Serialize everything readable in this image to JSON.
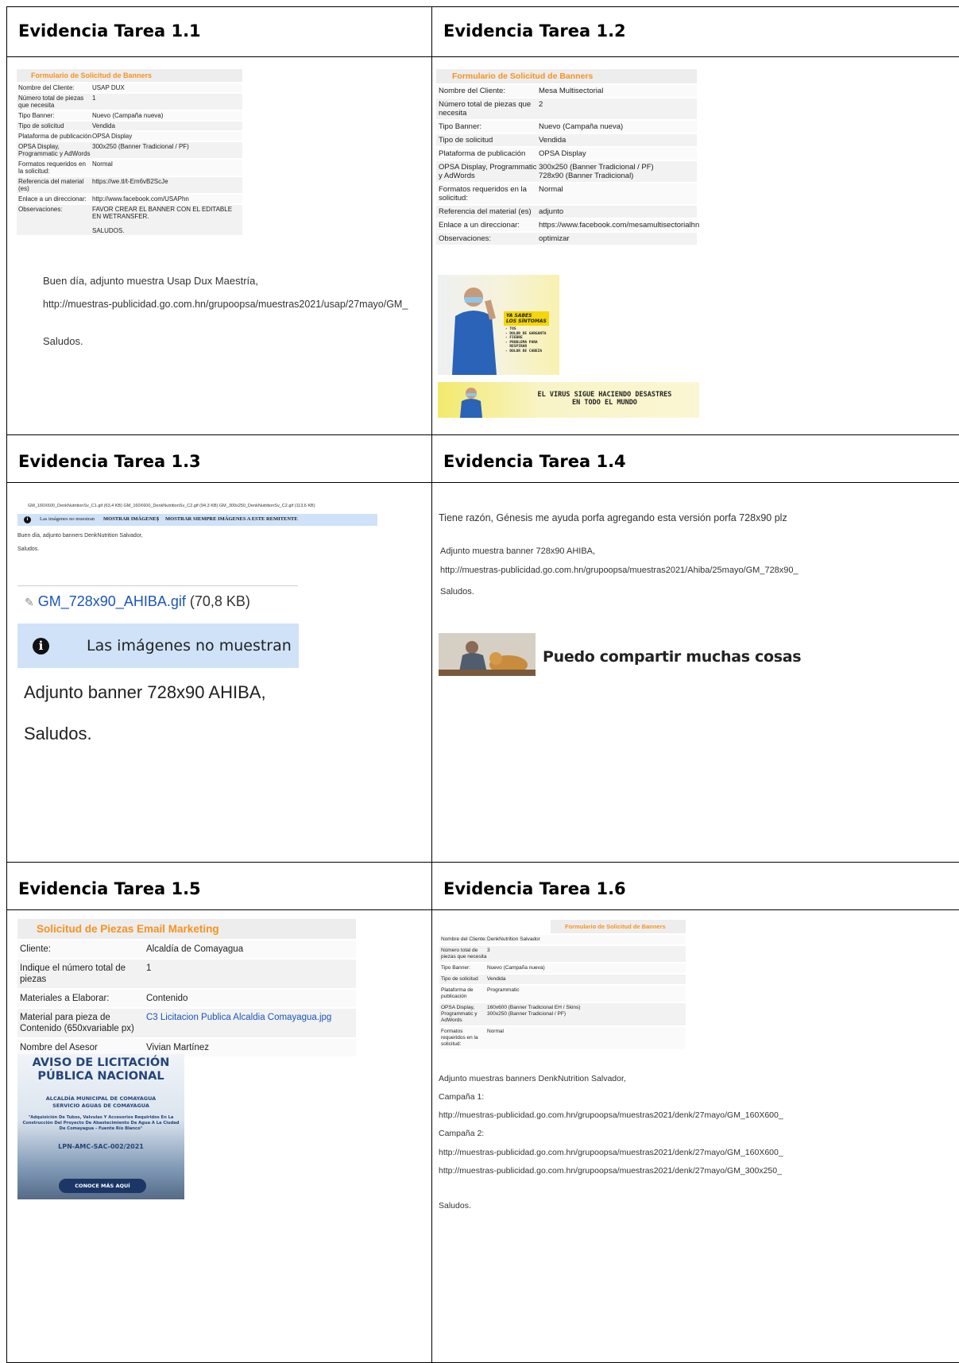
{
  "cells": [
    {
      "heading": "Evidencia Tarea 1.1"
    },
    {
      "heading": "Evidencia Tarea 1.2"
    },
    {
      "heading": "Evidencia Tarea 1.3"
    },
    {
      "heading": "Evidencia Tarea 1.4"
    },
    {
      "heading": "Evidencia Tarea 1.5"
    },
    {
      "heading": "Evidencia Tarea 1.6"
    }
  ],
  "t11": {
    "form_title": "Formulario de Solicitud de Banners",
    "rows": [
      {
        "k": "Nombre del Cliente:",
        "v": "USAP DUX"
      },
      {
        "k": "Número total de piezas que necesita",
        "v": "1"
      },
      {
        "k": "Tipo Banner:",
        "v": "Nuevo (Campaña nueva)"
      },
      {
        "k": "Tipo de solicitud",
        "v": "Vendida"
      },
      {
        "k": "Plataforma de publicación",
        "v": "OPSA Display"
      },
      {
        "k": "OPSA Display, Programmatic y AdWords",
        "v": "300x250 (Banner Tradicional / PF)"
      },
      {
        "k": "Formatos requeridos en la solicitud:",
        "v": "Normal"
      },
      {
        "k": "Referencia del material (es)",
        "v": "https://we.tl/t-Em6vB2ScJe"
      },
      {
        "k": "Enlace a un direccionar:",
        "v": "http://www.facebook.com/USAPhn"
      },
      {
        "k": "Observaciones:",
        "v": "FAVOR CREAR EL BANNER CON EL EDITABLE EN WETRANSFER.\n\nSALUDOS."
      }
    ],
    "msg": "Buen día, adjunto muestra Usap Dux Maestría,",
    "link": "http://muestras-publicidad.go.com.hn/grupoopsa/muestras2021/usap/27mayo/GM_",
    "bye": "Saludos."
  },
  "t12": {
    "form_title": "Formulario de Solicitud de Banners",
    "rows": [
      {
        "k": "Nombre del Cliente:",
        "v": "Mesa Multisectorial"
      },
      {
        "k": "Número total de piezas que necesita",
        "v": "2"
      },
      {
        "k": "Tipo Banner:",
        "v": "Nuevo (Campaña nueva)"
      },
      {
        "k": "Tipo de solicitud",
        "v": "Vendida"
      },
      {
        "k": "Plataforma de publicación",
        "v": "OPSA Display"
      },
      {
        "k": "OPSA Display, Programmatic y AdWords",
        "v": "300x250 (Banner Tradicional / PF)\n728x90 (Banner Tradicional)"
      },
      {
        "k": "Formatos requeridos en la solicitud:",
        "v": "Normal"
      },
      {
        "k": "Referencia del material (es)",
        "v": "adjunto"
      },
      {
        "k": "Enlace a un direccionar:",
        "v": "https://www.facebook.com/mesamultisectorialhn"
      },
      {
        "k": "Observaciones:",
        "v": "optimizar"
      }
    ],
    "banner1_title": "YA SABES\nLOS SÍNTOMAS",
    "banner1_list": "- TOS\n- DOLOR DE GARGANTA\n- FIEBRE\n- PROBLEMA PARA\n  RESPIRAR\n- DOLOR DE CABEZA",
    "banner2_text": "EL VIRUS SIGUE HACIENDO DESASTRES\nEN TODO EL MUNDO"
  },
  "t13": {
    "attachments": "GM_160X600_DenkNutritionSv_C1.gif (63,4 KB)   GM_160X600_DenkNutritionSv_C2.gif (94,3 KB)   GM_300x250_DenkNutritionSv_C2.gif (113,6 KB)",
    "bar_small_text": "Las imágenes no muestran",
    "bar_show": "MOSTRAR IMÁGENES",
    "bar_sep": "|",
    "bar_always": "MOSTRAR SIEMPRE IMÁGENES A ESTE REMITENTE",
    "small_msg": "Buen día, adjunto banners DenkNutrition Salvador,",
    "small_bye": "Saludos.",
    "big_attachment": "GM_728x90_AHIBA.gif",
    "big_attachment_size": "(70,8 KB)",
    "big_bar_text": "Las imágenes no muestran",
    "big_msg": "Adjunto banner 728x90 AHIBA,",
    "big_bye": "Saludos."
  },
  "t14": {
    "line1": "Tiene razón, Génesis me ayuda porfa agregando esta versión porfa 728x90 plz",
    "line2": "Adjunto muestra banner 728x90 AHIBA,",
    "link": "http://muestras-publicidad.go.com.hn/grupoopsa/muestras2021/Ahiba/25mayo/GM_728x90_",
    "bye": "Saludos.",
    "banner_text": "Puedo compartir muchas cosas"
  },
  "t15": {
    "form_title": "Solicitud de Piezas Email Marketing",
    "rows": [
      {
        "k": "Cliente:",
        "v": "Alcaldía de Comayagua"
      },
      {
        "k": "Indique el número total de piezas",
        "v": "1"
      },
      {
        "k": "Materiales a Elaborar:",
        "v": "Contenido"
      },
      {
        "k": "Material para pieza de Contenido (650xvariable px)",
        "v": "C3 Licitacion Publica Alcaldia Comayagua.jpg"
      },
      {
        "k": "Nombre del Asesor",
        "v": "Vivian Martínez"
      }
    ],
    "poster_title": "AVISO DE LICITACIÓN PÚBLICA NACIONAL",
    "poster_sub": "ALCALDÍA MUNICIPAL DE COMAYAGUA\nSERVICIO AGUAS DE COMAYAGUA",
    "poster_body": "\"Adquisición De Tubos, Valvulas Y Accesorios Requiridos En La Construcción Del Proyecto De Abastecimiento De Agua A La Ciudad De Comayagua - Fuente Río Blanco\"",
    "poster_code": "LPN-AMC-SAC-002/2021",
    "poster_button": "CONOCE MÁS AQUÍ"
  },
  "t16": {
    "form_title": "Formulario de Solicitud de Banners",
    "rows": [
      {
        "k": "Nombre del Cliente:",
        "v": "DenkNutrition Salvador"
      },
      {
        "k": "Número total de piezas que necesita",
        "v": "3"
      },
      {
        "k": "Tipo Banner:",
        "v": "Nuevo (Campaña nueva)"
      },
      {
        "k": "Tipo de solicitud",
        "v": "Vendida"
      },
      {
        "k": "Plataforma de publicación",
        "v": "Programmatic"
      },
      {
        "k": "OPSA Display, Programmatic y AdWords",
        "v": "160x600 (Banner Tradicional EH / Skins)\n300x250 (Banner Tradicional / PF)"
      },
      {
        "k": "Formatos requeridos en la solicitud:",
        "v": "Normal"
      }
    ],
    "msg": "Adjunto muestras banners DenkNutrition Salvador,",
    "c1": "Campaña 1:",
    "link1": "http://muestras-publicidad.go.com.hn/grupoopsa/muestras2021/denk/27mayo/GM_160X600_",
    "c2": "Campaña 2:",
    "link2": "http://muestras-publicidad.go.com.hn/grupoopsa/muestras2021/denk/27mayo/GM_160X600_",
    "link3": "http://muestras-publicidad.go.com.hn/grupoopsa/muestras2021/denk/27mayo/GM_300x250_",
    "bye": "Saludos."
  }
}
